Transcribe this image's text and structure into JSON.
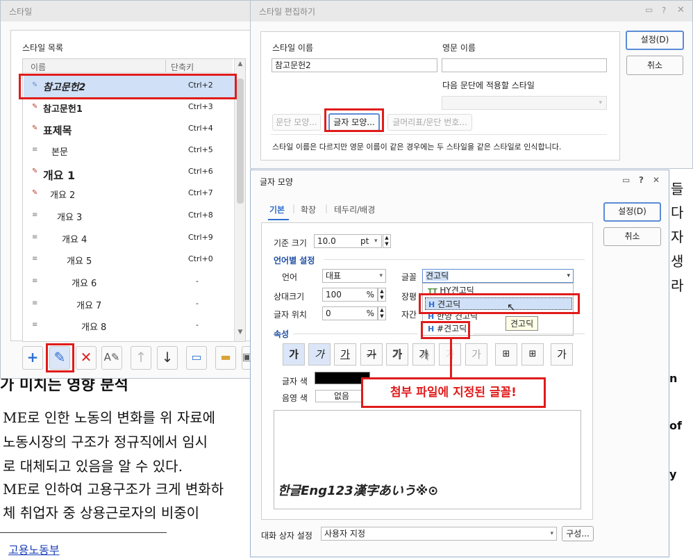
{
  "document": {
    "lines": [
      "가 미치는 영향 분석",
      "ME로 인한 노동의 변화를 위 자료에",
      "노동시장의 구조가 정규직에서 임시",
      "로 대체되고 있음을 알 수 있다.",
      "ME로 인하여 고용구조가 크게 변화하",
      "체 취업자 중 상용근로자의 비중이"
    ],
    "footnote": "고용노동부",
    "right_chars": [
      "들",
      "다",
      "자",
      "생",
      "라"
    ],
    "right_eng": [
      "n",
      "of",
      "y"
    ]
  },
  "style_dialog": {
    "title": "스타일",
    "list_label": "스타일 목록",
    "col_name": "이름",
    "col_key": "단축키",
    "items": [
      {
        "name": "참고문헌2",
        "key": "Ctrl+2"
      },
      {
        "name": "참고문헌1",
        "key": "Ctrl+3"
      },
      {
        "name": "표제목",
        "key": "Ctrl+4"
      },
      {
        "name": "본문",
        "key": "Ctrl+5"
      },
      {
        "name": "개요 1",
        "key": "Ctrl+6"
      },
      {
        "name": "개요 2",
        "key": "Ctrl+7"
      },
      {
        "name": "개요 3",
        "key": "Ctrl+8"
      },
      {
        "name": "개요 4",
        "key": "Ctrl+9"
      },
      {
        "name": "개요 5",
        "key": "Ctrl+0"
      },
      {
        "name": "개요 6",
        "key": "-"
      },
      {
        "name": "개요 7",
        "key": "-"
      },
      {
        "name": "개요 8",
        "key": "-"
      }
    ]
  },
  "edit_dialog": {
    "title": "스타일 편집하기",
    "name_label": "스타일 이름",
    "eng_label": "영문 이름",
    "name_value": "참고문헌2",
    "eng_value": "",
    "next_label": "다음 문단에 적용할 스타일",
    "btn_para": "문단 모양...",
    "btn_char": "글자 모양...",
    "btn_bullet": "글머리표/문단 번호...",
    "note": "스타일 이름은 다르지만 영문 이름이 같은 경우에는 두 스타일을 같은 스타일로 인식합니다.",
    "ok": "설정(D)",
    "cancel": "취소"
  },
  "char_dialog": {
    "title": "글자 모양",
    "tabs": [
      "기본",
      "확장",
      "테두리/배경"
    ],
    "base_size_label": "기준 크기",
    "base_size_value": "10.0",
    "base_size_unit": "pt",
    "lang_section": "언어별 설정",
    "lang_label": "언어",
    "lang_value": "대표",
    "font_label": "글꼴",
    "font_value": "견고딕",
    "rel_size_label": "상대크기",
    "rel_size_value": "100",
    "pct": "%",
    "ratio_label": "장평",
    "pos_label": "글자 위치",
    "pos_value": "0",
    "spacing_label": "자간",
    "font_options": [
      "HY견고딕",
      "견고딕",
      "한양 견고딕",
      "#견고딕"
    ],
    "tooltip": "견고딕",
    "attr_section": "속성",
    "attr_glyph": "가",
    "color_label": "글자 색",
    "shade_label": "음영 색",
    "shade_value": "없음",
    "preview_text": "한글Eng123漢字あいう※⊙",
    "dialog_setting_label": "대화 상자 설정",
    "dialog_setting_value": "사용자 지정",
    "configure": "구성...",
    "ok": "설정(D)",
    "cancel": "취소"
  },
  "callout": "첨부 파일에 지정된 글꼴!",
  "colors": {
    "accent": "#e01b1b",
    "selection": "#cfe0f7"
  }
}
